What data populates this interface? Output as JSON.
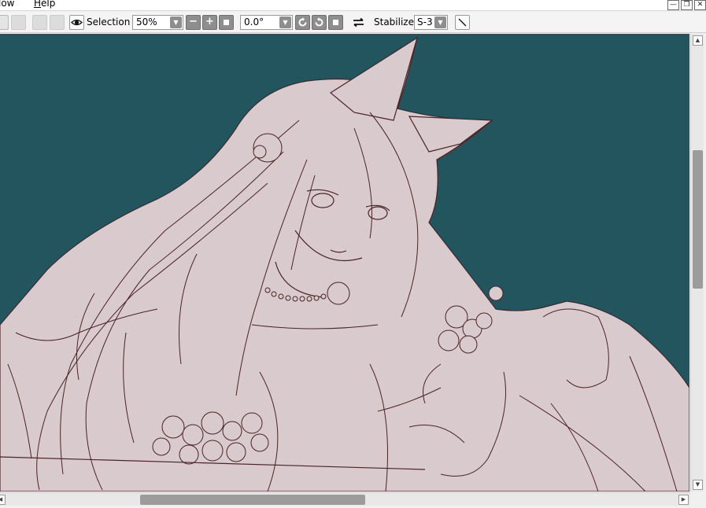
{
  "menubar": {
    "items": [
      {
        "pre": "",
        "accel": "",
        "post": "low"
      },
      {
        "pre": "",
        "accel": "H",
        "post": "elp"
      }
    ],
    "window_controls": [
      "minimize-icon",
      "restore-icon",
      "close-icon"
    ]
  },
  "toolbar": {
    "selection_label": "Selection",
    "zoom_value": "50%",
    "rotation_value": "0.0°",
    "stabilizer_label": "Stabilizer",
    "stabilizer_value": "S-3",
    "icons": {
      "eye": "eye-icon",
      "zoom_out": "minus-icon",
      "zoom_in": "plus-icon",
      "zoom_reset": "square-icon",
      "rotate_left": "rotate-ccw-icon",
      "rotate_right": "rotate-cw-icon",
      "rotate_reset": "square-icon",
      "flip": "flip-horizontal-icon",
      "pen": "pen-line-icon"
    }
  },
  "canvas": {
    "background": "#23555f",
    "fill_color": "#d8cacd",
    "line_color": "#4a2327"
  },
  "scrollbars": {
    "vertical_position": 0.3,
    "horizontal_position": 0.24
  }
}
